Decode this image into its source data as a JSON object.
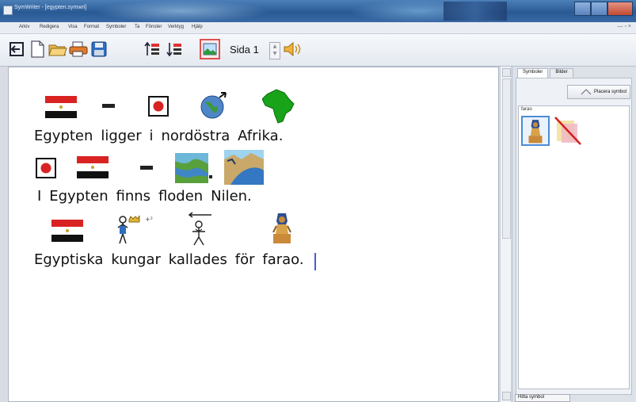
{
  "window": {
    "title": "SymWriter - [egypten.symwri]"
  },
  "menu": {
    "items": [
      "Arkiv",
      "Redigera",
      "Visa",
      "Format",
      "Symboler",
      "Ta",
      "Fönster",
      "Verktyg",
      "Hjälp"
    ]
  },
  "toolbar": {
    "page_label": "Sida 1",
    "icons": [
      "exit-icon",
      "new-document-icon",
      "open-folder-icon",
      "print-icon",
      "save-icon",
      "increase-spacing-icon",
      "decrease-spacing-icon",
      "picture-icon",
      "speaker-icon"
    ]
  },
  "document": {
    "lines": [
      {
        "text": [
          "Egypten",
          "ligger",
          "i",
          "nordöstra",
          "Afrika."
        ]
      },
      {
        "text": [
          "I",
          "Egypten",
          "finns",
          "floden",
          "Nilen."
        ]
      },
      {
        "text": [
          "Egyptiska",
          "kungar",
          "kallades",
          "för",
          "farao."
        ]
      }
    ]
  },
  "panel": {
    "tabs": [
      "Symboler",
      "Bilder"
    ],
    "place_button": "Placera symbol",
    "list_header": "farao",
    "find_button": "Hitta symbol"
  },
  "colors": {
    "flag_red": "#d92323",
    "flag_black": "#111111",
    "africa_green": "#19a319",
    "caret": "#4a5ad8",
    "selection": "#e05050"
  }
}
